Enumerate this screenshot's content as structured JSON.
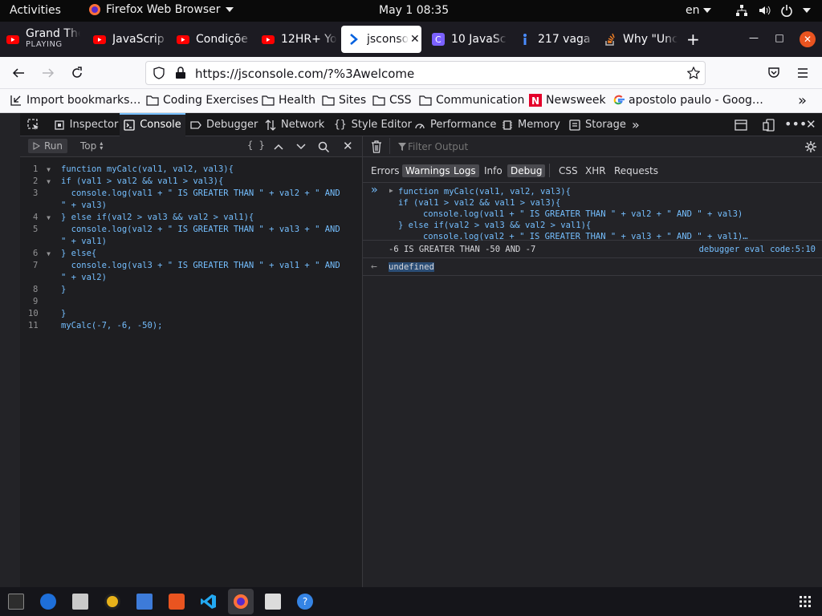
{
  "system_bar": {
    "activities": "Activities",
    "app_name": "Firefox Web Browser",
    "clock": "May 1  08:35",
    "language": "en"
  },
  "tabs": [
    {
      "title": "Grand The",
      "subtitle": "PLAYING",
      "icon": "youtube-icon"
    },
    {
      "title": "JavaScrip",
      "icon": "youtube-icon"
    },
    {
      "title": "Condiçõe",
      "icon": "youtube-icon"
    },
    {
      "title": "12HR+ Yo",
      "icon": "youtube-icon"
    },
    {
      "title": "jsconso",
      "icon": "jsconsole-icon",
      "active": true
    },
    {
      "title": "10 JavaSc",
      "icon": "c-site-icon"
    },
    {
      "title": "217 vaga",
      "icon": "info-site-icon"
    },
    {
      "title": "Why \"Unc",
      "icon": "stackoverflow-icon"
    }
  ],
  "navbar": {
    "url": "https://jsconsole.com/?%3Awelcome"
  },
  "bookmarks": [
    {
      "label": "Import bookmarks…",
      "icon": "import-icon"
    },
    {
      "label": "Coding Exercises",
      "icon": "folder-icon"
    },
    {
      "label": "Health",
      "icon": "folder-icon"
    },
    {
      "label": "Sites",
      "icon": "folder-icon"
    },
    {
      "label": "CSS",
      "icon": "folder-icon"
    },
    {
      "label": "Communication",
      "icon": "folder-icon"
    },
    {
      "label": "Newsweek",
      "icon": "newsweek-icon"
    },
    {
      "label": "apostolo paulo - Goog…",
      "icon": "google-icon"
    }
  ],
  "devtools": {
    "tabs": [
      "Inspector",
      "Console",
      "Debugger",
      "Network",
      "Style Editor",
      "Performance",
      "Memory",
      "Storage"
    ],
    "selected_tab": "Console",
    "run_label": "Run",
    "context": "Top",
    "filter_placeholder": "Filter Output",
    "filters": [
      {
        "label": "Errors",
        "on": false
      },
      {
        "label": "Warnings",
        "on": true
      },
      {
        "label": "Logs",
        "on": true
      },
      {
        "label": "Info",
        "on": false
      },
      {
        "label": "Debug",
        "on": true
      },
      {
        "label": "CSS",
        "on": false
      },
      {
        "label": "XHR",
        "on": false
      },
      {
        "label": "Requests",
        "on": false
      }
    ]
  },
  "editor": {
    "lines": [
      "function myCalc(val1, val2, val3){",
      "if (val1 > val2 && val1 > val3){",
      "  console.log(val1 + \" IS GREATER THAN \" + val2 + \" AND",
      "\" + val3)",
      "} else if(val2 > val3 && val2 > val1){",
      "  console.log(val2 + \" IS GREATER THAN \" + val3 + \" AND",
      "\" + val1)",
      "} else{",
      "  console.log(val3 + \" IS GREATER THAN \" + val1 + \" AND",
      "\" + val2)",
      "}",
      "",
      "}",
      "myCalc(-7, -6, -50);"
    ],
    "gutter": [
      "1",
      "2",
      "3",
      "",
      "4",
      "5",
      "",
      "6",
      "7",
      "",
      "8",
      "9",
      "10",
      "11"
    ]
  },
  "output": {
    "echo": [
      "function myCalc(val1, val2, val3){",
      "if (val1 > val2 && val1 > val3){",
      "   console.log(val1 + \" IS GREATER THAN \" + val2 + \" AND \" + val3)",
      "} else if(val2 > val3 && val2 > val1){",
      "   console.log(val2 + \" IS GREATER THAN \" + val3 + \" AND \" + val1)…"
    ],
    "log_message": "-6 IS GREATER THAN -50 AND -7",
    "log_source": "debugger eval code:5:10",
    "result": "undefined"
  }
}
